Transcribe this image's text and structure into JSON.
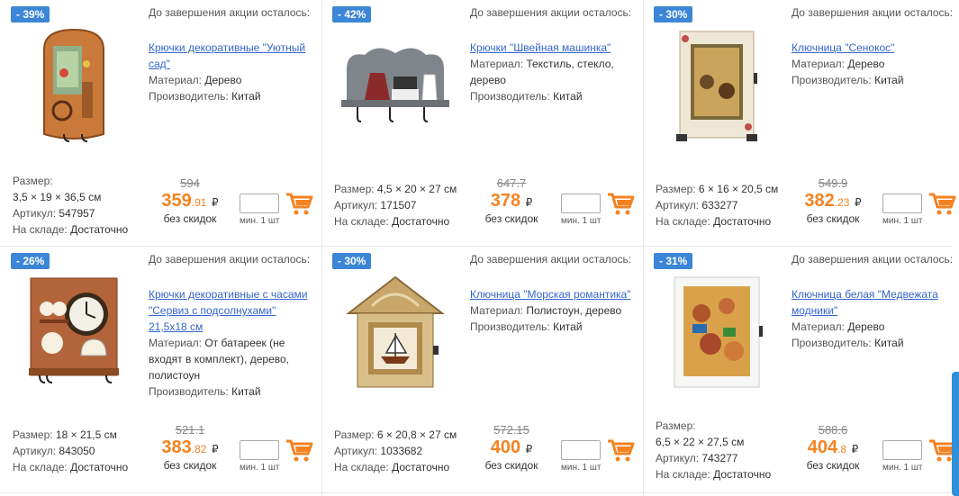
{
  "accent": "#f58220",
  "badge_color": "#3b86d6",
  "link_color": "#3366cc",
  "labels": {
    "timer": "До завершения акции осталось:",
    "material": "Материал:",
    "producer": "Производитель:",
    "size": "Размер:",
    "article": "Артикул:",
    "stock": "На складе:",
    "no_discount": "без скидок",
    "min_qty": "мин. 1 шт",
    "currency": "₽"
  },
  "products": [
    {
      "badge": "- 39%",
      "title": "Крючки декоративные \"Уютный сад\"",
      "material": "Дерево",
      "producer": "Китай",
      "size": "3,5 × 19 × 36,5 см",
      "article": "547957",
      "stock": "Достаточно",
      "old_price": "594",
      "price_int": "359",
      "price_frac": ".91",
      "icon": "hook-garden-image"
    },
    {
      "badge": "- 42%",
      "title": "Крючки \"Швейная машинка\"",
      "material": "Текстиль, стекло, дерево",
      "producer": "Китай",
      "size": "4,5 × 20 × 27 см",
      "article": "171507",
      "stock": "Достаточно",
      "old_price": "647.7",
      "price_int": "378",
      "price_frac": "",
      "icon": "hook-sewing-image"
    },
    {
      "badge": "- 30%",
      "title": "Ключница \"Сенокос\"",
      "material": "Дерево",
      "producer": "Китай",
      "size": "6 × 16 × 20,5 см",
      "article": "633277",
      "stock": "Достаточно",
      "old_price": "549.9",
      "price_int": "382",
      "price_frac": ".23",
      "icon": "key-box-haymaking-image"
    },
    {
      "badge": "- 26%",
      "title": "Крючки декоративные с часами \"Сервиз с подсолнухами\" 21,5х18 см",
      "material": "От батареек (не входят в комплект), дерево, полистоун",
      "producer": "Китай",
      "size": "18 × 21,5 см",
      "article": "843050",
      "stock": "Достаточно",
      "old_price": "521.1",
      "price_int": "383",
      "price_frac": ".82",
      "icon": "clock-hooks-image"
    },
    {
      "badge": "- 30%",
      "title": "Ключница \"Морская романтика\"",
      "material": "Полистоун, дерево",
      "producer": "Китай",
      "size": "6 × 20,8 × 27 см",
      "article": "1033682",
      "stock": "Достаточно",
      "old_price": "572.15",
      "price_int": "400",
      "price_frac": "",
      "icon": "key-box-sea-image"
    },
    {
      "badge": "- 31%",
      "title": "Ключница белая \"Медвежата модники\"",
      "material": "Дерево",
      "producer": "Китай",
      "size": "6,5 × 22 × 27,5 см",
      "article": "743277",
      "stock": "Достаточно",
      "old_price": "588.6",
      "price_int": "404",
      "price_frac": ".8",
      "icon": "key-box-bears-image"
    }
  ]
}
